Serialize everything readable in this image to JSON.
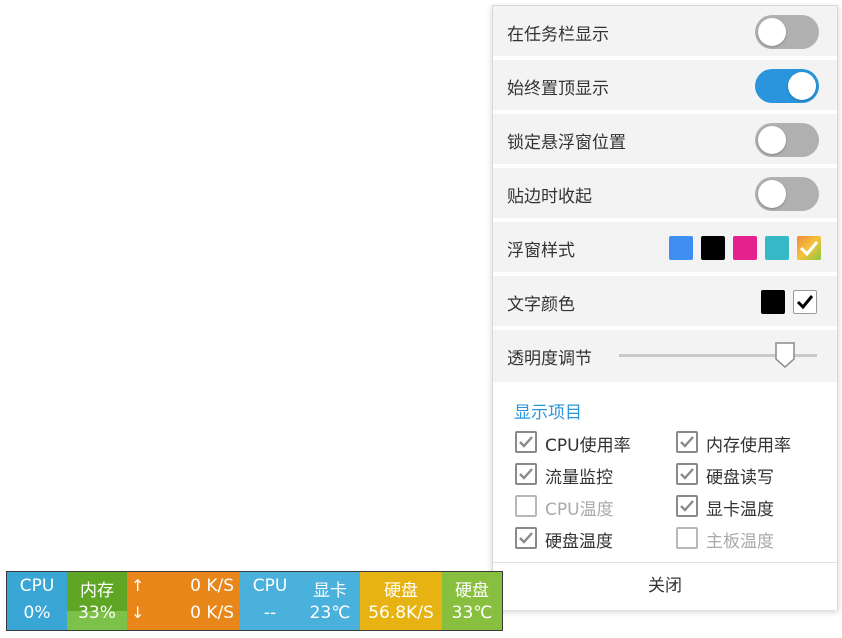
{
  "settings": {
    "rows": [
      {
        "label": "在任务栏显示",
        "toggle": false
      },
      {
        "label": "始终置顶显示",
        "toggle": true
      },
      {
        "label": "锁定悬浮窗位置",
        "toggle": false
      },
      {
        "label": "贴边时收起",
        "toggle": false
      }
    ],
    "window_style": {
      "label": "浮窗样式",
      "swatches": [
        "#3d8ef0",
        "#000000",
        "#e4218d",
        "#35b9c6",
        "#f4a63a"
      ],
      "selected_index": 4
    },
    "text_color": {
      "label": "文字颜色",
      "swatches": [
        "#000000",
        "#ffffff"
      ],
      "selected_index": 1
    },
    "opacity": {
      "label": "透明度调节",
      "value_fraction": 0.84
    },
    "display_items": {
      "title": "显示项目",
      "items": [
        {
          "label": "CPU使用率",
          "checked": true
        },
        {
          "label": "内存使用率",
          "checked": true
        },
        {
          "label": "流量监控",
          "checked": true
        },
        {
          "label": "硬盘读写",
          "checked": true
        },
        {
          "label": "CPU温度",
          "checked": false
        },
        {
          "label": "显卡温度",
          "checked": true
        },
        {
          "label": "硬盘温度",
          "checked": true
        },
        {
          "label": "主板温度",
          "checked": false
        }
      ]
    },
    "close_label": "关闭"
  },
  "monitor_bar": {
    "cpu": {
      "label": "CPU",
      "value": "0%",
      "color": "#3aa6d6"
    },
    "memory": {
      "label": "内存",
      "value": "33%",
      "color": "#5ea624",
      "fill_color": "#7cc14a",
      "fill_fraction": 0.33
    },
    "network": {
      "up_icon": "↑",
      "up_value": "0 K/S",
      "down_icon": "↓",
      "down_value": "0 K/S",
      "color": "#e8861a"
    },
    "cpu_temp": {
      "label": "CPU",
      "value": "--",
      "color": "#4ab0dc"
    },
    "gpu_temp": {
      "label": "显卡",
      "value": "23℃",
      "color": "#4ab0dc"
    },
    "disk_rw": {
      "label": "硬盘",
      "value": "56.8K/S",
      "color": "#e6b312"
    },
    "disk_temp": {
      "label": "硬盘",
      "value": "33℃",
      "color": "#88bf3f"
    }
  }
}
